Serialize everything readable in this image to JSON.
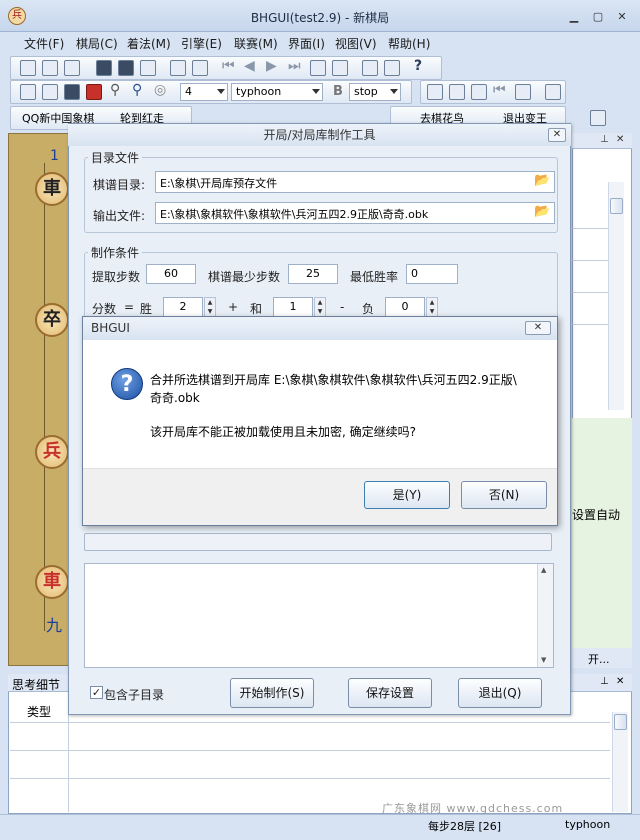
{
  "window": {
    "title": "BHGUI(test2.9) - 新棋局",
    "app_icon_char": "兵"
  },
  "menu": [
    "文件(F)",
    "棋局(C)",
    "着法(M)",
    "引擎(E)",
    "联赛(M)",
    "界面(I)",
    "视图(V)",
    "帮助(H)"
  ],
  "toolbar": {
    "depth_value": "4",
    "engine_value": "typhoon",
    "stop_value": "stop",
    "bold_b": "B",
    "help_q": "?"
  },
  "toolbar3": {
    "qq_combo": "QQ新中国象棋",
    "turn_combo": "轮到红走",
    "left_combo": "去棋花鸟",
    "right_combo": "退出变王"
  },
  "board": {
    "file_top": "1",
    "file_bottom": "九",
    "pieces": [
      "車",
      "卒",
      "兵",
      "車"
    ]
  },
  "right_panel": {
    "partial_text": "设置自动",
    "tab_partial": "开..."
  },
  "bottom_panel": {
    "title": "思考细节",
    "col_type": "类型"
  },
  "statusbar": {
    "moves": "每步28层 [26]",
    "engine": "typhoon",
    "watermark": "广东象棋网 www.gdchess.com"
  },
  "dialog": {
    "title": "开局/对局库制作工具",
    "dir_group": "目录文件",
    "dir_label": "棋谱目录:",
    "dir_value": "E:\\象棋\\开局库预存文件",
    "out_label": "输出文件:",
    "out_value": "E:\\象棋\\象棋软件\\象棋软件\\兵河五四2.9正版\\奇奇.obk",
    "cond_group": "制作条件",
    "steps_label": "提取步数",
    "steps_value": "60",
    "min_steps_label": "棋谱最少步数",
    "min_steps_value": "25",
    "winrate_label": "最低胜率",
    "winrate_value": "0",
    "score_label": "分数",
    "eq": "=",
    "win_label": "胜",
    "win_value": "2",
    "plus": "+",
    "draw_label": "和",
    "draw_value": "1",
    "minus": "-",
    "loss_label": "负",
    "loss_value": "0",
    "subdir_label": "包含子目录",
    "subdir_checked": true,
    "start_button": "开始制作(S)",
    "save_button": "保存设置",
    "exit_button": "退出(Q)"
  },
  "message_box": {
    "title": "BHGUI",
    "line1": "合并所选棋谱到开局库 E:\\象棋\\象棋软件\\象棋软件\\兵河五四2.9正版\\",
    "line2": "奇奇.obk",
    "line3": "该开局库不能正被加载使用且未加密, 确定继续吗?",
    "yes_button": "是(Y)",
    "no_button": "否(N)"
  },
  "colors": {
    "accent": "#1a4fa2",
    "red_piece": "#c8302a",
    "black_piece": "#222222"
  }
}
